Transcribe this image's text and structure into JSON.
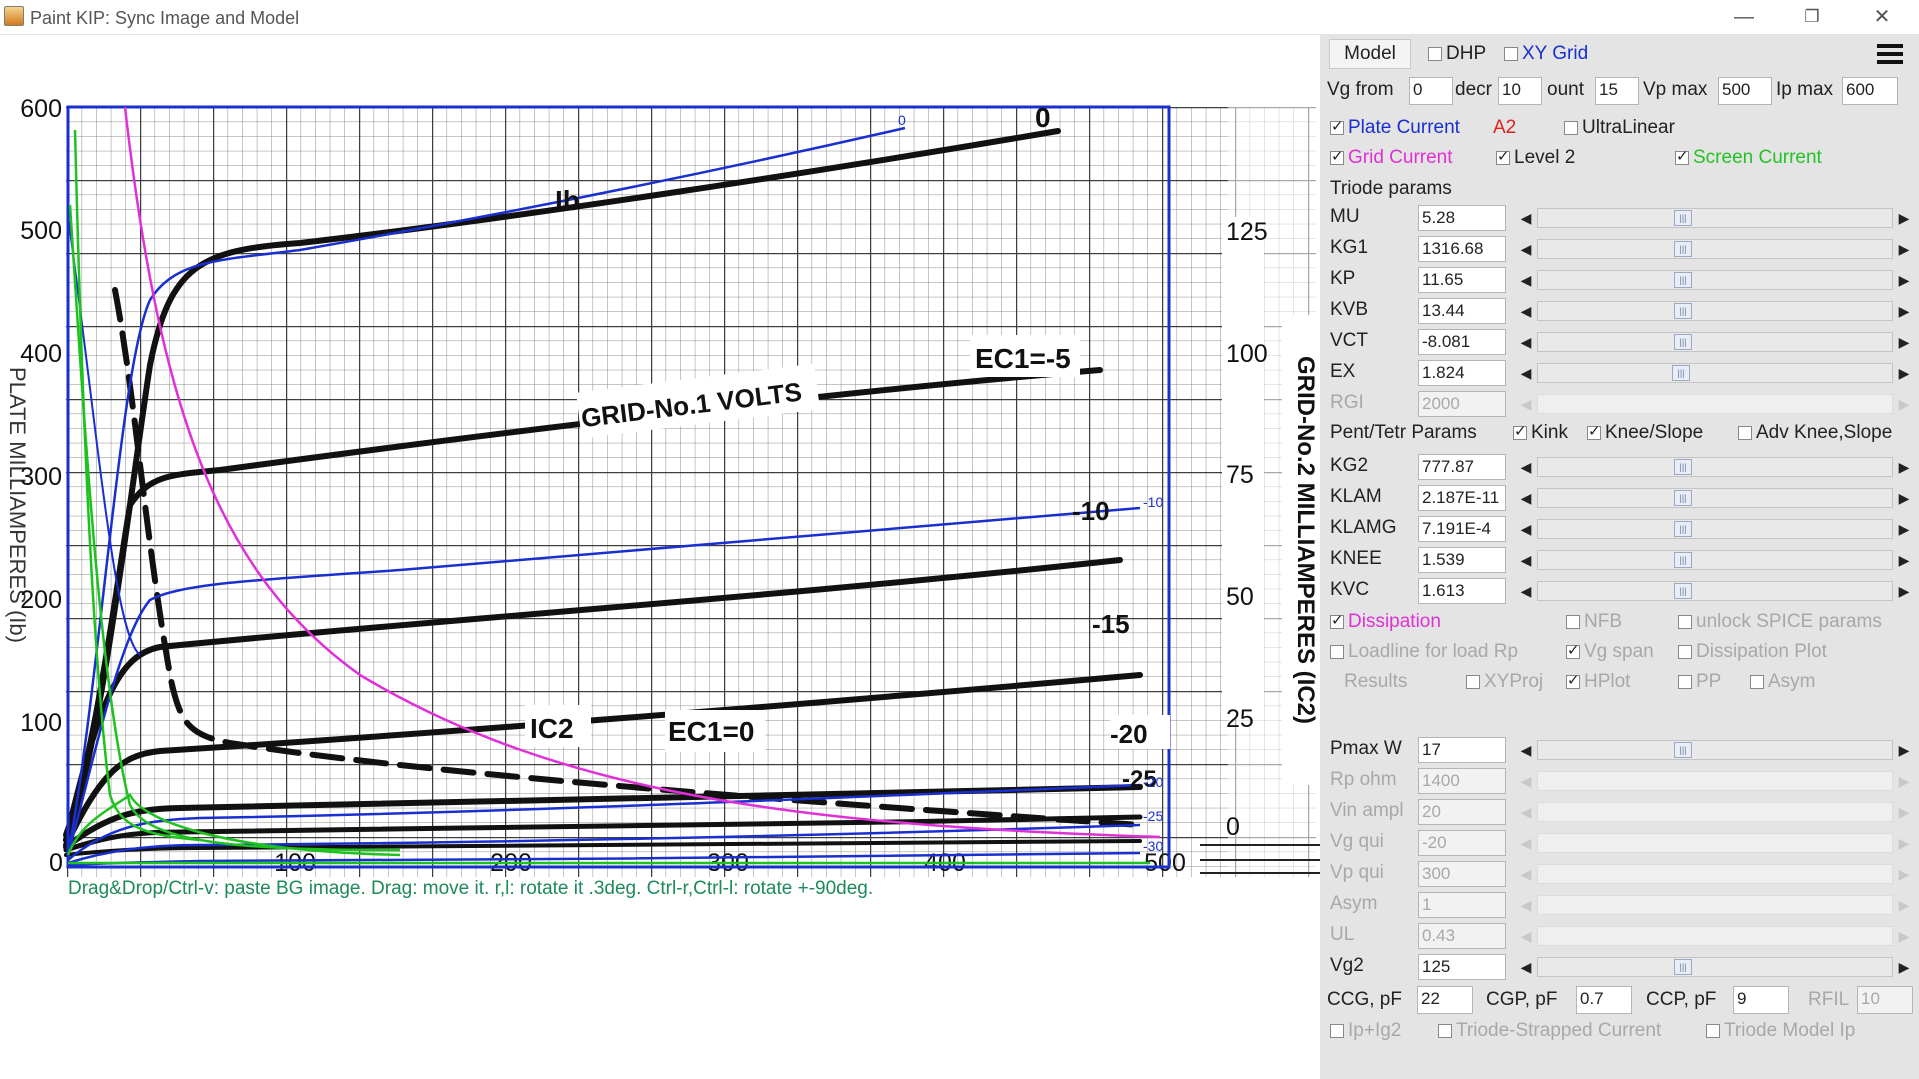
{
  "window": {
    "title": "Paint KIP: Sync Image and Model",
    "minimize": "—",
    "restore": "❐",
    "close": "✕"
  },
  "hint": "Drag&Drop/Ctrl-v: paste BG image. Drag: move it. r,l: rotate it .3deg. Ctrl-r,Ctrl-l: rotate +-90deg.",
  "chart": {
    "y_ticks": [
      "600",
      "500",
      "400",
      "300",
      "200",
      "100"
    ],
    "x_ticks": [
      "0",
      "100",
      "200",
      "300",
      "400",
      "500"
    ],
    "y2_ticks": [
      "125",
      "100",
      "75",
      "50",
      "25",
      "0"
    ],
    "y2_label": "GRID-No.2 MILLIAMPERES (IC2)",
    "y_left_label": "PLATE MILLIAMPERES (Ib)",
    "ann_ib": "Ib",
    "ann_grid": "GRID-No.1 VOLTS",
    "ann_ec5": "EC1=-5",
    "ann_m10": "-10",
    "ann_m15": "-15",
    "ann_m20": "-20",
    "ann_m25": "-25",
    "ann_ic2": "IC2",
    "ann_ec0": "EC1=0",
    "ann_0": "0",
    "blue_0": "0",
    "blue_m10": "-10",
    "blue_m20": "-20",
    "blue_m25": "-25",
    "blue_m30": "-30"
  },
  "panel": {
    "model_btn": "Model",
    "dhp": "DHP",
    "xygrid": "XY Grid",
    "vg_from_lbl": "Vg from",
    "vg_from": "0",
    "decr_lbl": "decr",
    "decr": "10",
    "count_lbl": "ount",
    "count": "15",
    "vpmax_lbl": "Vp max",
    "vpmax": "500",
    "ipmax_lbl": "Ip max",
    "ipmax": "600",
    "plate_current": "Plate Current",
    "a2": "A2",
    "ultralinear": "UltraLinear",
    "grid_current": "Grid Current",
    "level2": "Level 2",
    "screen_current": "Screen Current",
    "triode_params": "Triode params",
    "triode": [
      {
        "label": "MU",
        "value": "5.28"
      },
      {
        "label": "KG1",
        "value": "1316.68"
      },
      {
        "label": "KP",
        "value": "11.65"
      },
      {
        "label": "KVB",
        "value": "13.44"
      },
      {
        "label": "VCT",
        "value": "-8.081"
      },
      {
        "label": "EX",
        "value": "1.824"
      },
      {
        "label": "RGI",
        "value": "2000"
      }
    ],
    "pent_params": "Pent/Tetr Params",
    "kink": "Kink",
    "knee_slope": "Knee/Slope",
    "adv_knee": "Adv Knee,Slope",
    "pent": [
      {
        "label": "KG2",
        "value": "777.87"
      },
      {
        "label": "KLAM",
        "value": "2.187E-11"
      },
      {
        "label": "KLAMG",
        "value": "7.191E-4"
      },
      {
        "label": "KNEE",
        "value": "1.539"
      },
      {
        "label": "KVC",
        "value": "1.613"
      }
    ],
    "dissipation": "Dissipation",
    "nfb": "NFB",
    "unlock_spice": "unlock SPICE params",
    "loadline": "Loadline for load Rp",
    "vg_span": "Vg span",
    "dissipation_plot": "Dissipation Plot",
    "results": "Results",
    "xyproj": "XYProj",
    "hplot": "HPlot",
    "pp": "PP",
    "asym_cb": "Asym",
    "lower": [
      {
        "label": "Pmax W",
        "value": "17"
      },
      {
        "label": "Rp ohm",
        "value": "1400"
      },
      {
        "label": "Vin ampl",
        "value": "20"
      },
      {
        "label": "Vg qui",
        "value": "-20"
      },
      {
        "label": "Vp qui",
        "value": "300"
      },
      {
        "label": "Asym",
        "value": "1"
      },
      {
        "label": "UL",
        "value": "0.43"
      },
      {
        "label": "Vg2",
        "value": "125"
      }
    ],
    "ccg_lbl": "CCG, pF",
    "ccg": "22",
    "cgp_lbl": "CGP, pF",
    "cgp": "0.7",
    "ccp_lbl": "CCP, pF",
    "ccp": "9",
    "rfil_lbl": "RFIL",
    "rfil": "10",
    "ip_ig2": "Ip+Ig2",
    "triode_strapped": "Triode-Strapped Current",
    "triode_model_ip": "Triode Model Ip"
  },
  "colors": {
    "blue_curve": "#1a2fd0",
    "green_curve": "#1ec21e",
    "magenta_curve": "#e030d8",
    "black_curve": "#111111",
    "plate_label": "#1a2fd0",
    "red_label": "#e02020",
    "grid_label": "#e030d8",
    "screen_label": "#22c322"
  }
}
